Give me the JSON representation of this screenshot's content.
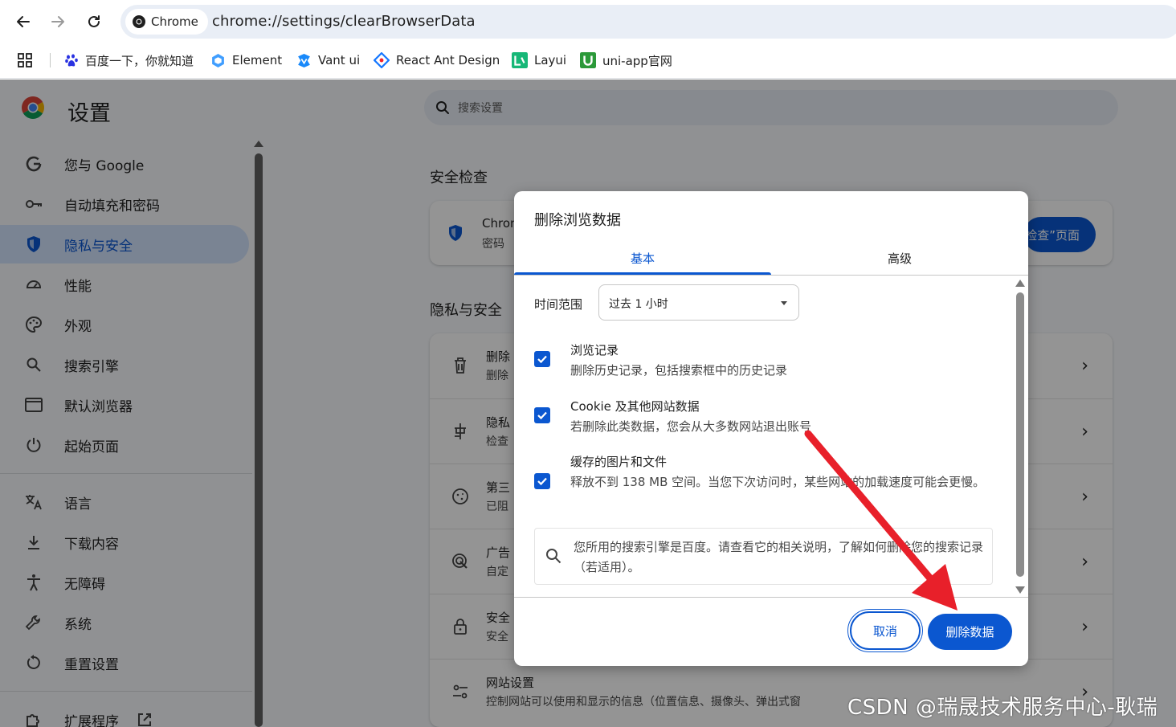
{
  "browser": {
    "chip_label": "Chrome",
    "url": "chrome://settings/clearBrowserData",
    "bookmarks": [
      {
        "label": "百度一下，你就知道",
        "icon": "baidu-paw-icon"
      },
      {
        "label": "Element",
        "icon": "element-logo-icon"
      },
      {
        "label": "Vant ui",
        "icon": "vant-logo-icon"
      },
      {
        "label": "React Ant Design",
        "icon": "ant-design-logo-icon"
      },
      {
        "label": "Layui",
        "icon": "layui-logo-icon"
      },
      {
        "label": "uni-app官网",
        "icon": "uniapp-logo-icon"
      }
    ]
  },
  "settings": {
    "title": "设置",
    "search_placeholder": "搜索设置",
    "sidebar": [
      {
        "label": "您与 Google",
        "icon": "google-g-icon"
      },
      {
        "label": "自动填充和密码",
        "icon": "key-icon"
      },
      {
        "label": "隐私与安全",
        "icon": "shield-icon",
        "active": true
      },
      {
        "label": "性能",
        "icon": "speedometer-icon"
      },
      {
        "label": "外观",
        "icon": "palette-icon"
      },
      {
        "label": "搜索引擎",
        "icon": "search-icon"
      },
      {
        "label": "默认浏览器",
        "icon": "browser-window-icon"
      },
      {
        "label": "起始页面",
        "icon": "power-icon"
      },
      {
        "label": "语言",
        "icon": "translate-icon"
      },
      {
        "label": "下载内容",
        "icon": "download-icon"
      },
      {
        "label": "无障碍",
        "icon": "accessibility-icon"
      },
      {
        "label": "系统",
        "icon": "wrench-icon"
      },
      {
        "label": "重置设置",
        "icon": "reset-icon"
      },
      {
        "label": "扩展程序",
        "icon": "puzzle-icon"
      }
    ],
    "safety_heading": "安全检查",
    "safety_card": {
      "title": "Chron",
      "subtitle": "密码",
      "button": "检查”页面"
    },
    "privacy_heading": "隐私与安全",
    "privacy_rows": [
      {
        "t1": "删除",
        "t2": "删除",
        "icon": "trash-icon"
      },
      {
        "t1": "隐私",
        "t2": "检查",
        "icon": "privacy-guide-icon"
      },
      {
        "t1": "第三",
        "t2": "已阻",
        "icon": "cookie-icon"
      },
      {
        "t1": "广告",
        "t2": "自定",
        "icon": "ad-privacy-icon"
      },
      {
        "t1": "安全",
        "t2": "安全",
        "icon": "lock-icon"
      },
      {
        "t1": "网站设置",
        "t2": "控制网站可以使用和显示的信息（位置信息、摄像头、弹出式窗",
        "icon": "tune-icon"
      }
    ]
  },
  "dialog": {
    "title": "删除浏览数据",
    "tabs": [
      "基本",
      "高级"
    ],
    "time_range_label": "时间范围",
    "time_range_value": "过去 1 小时",
    "options": [
      {
        "title": "浏览记录",
        "desc": "删除历史记录，包括搜索框中的历史记录",
        "checked": true
      },
      {
        "title": "Cookie 及其他网站数据",
        "desc": "若删除此类数据，您会从大多数网站退出账号",
        "checked": true
      },
      {
        "title": "缓存的图片和文件",
        "desc": "释放不到 138 MB 空间。当您下次访问时，某些网站的加载速度可能会更慢。",
        "checked": true
      }
    ],
    "notice": "您所用的搜索引擎是百度。请查看它的相关说明，了解如何删除您的搜索记录（若适用）。",
    "cancel_label": "取消",
    "delete_label": "删除数据"
  },
  "watermark": "CSDN @瑞晟技术服务中心-耿瑞",
  "colors": {
    "accent": "#0b57d0",
    "annotation_arrow": "#e8202a"
  }
}
